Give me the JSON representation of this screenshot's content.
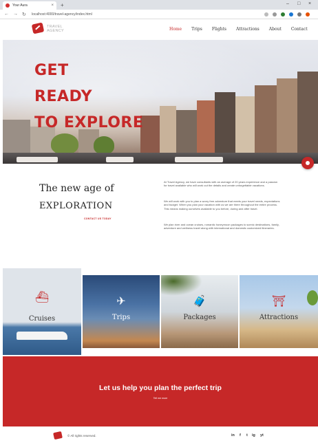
{
  "browser": {
    "tab_title": "Your Aura",
    "tab_close": "×",
    "new_tab": "+",
    "back": "←",
    "forward": "→",
    "reload": "↻",
    "url": "localhost:4000/travel-agency/index.html",
    "min": "–",
    "max": "□",
    "close": "×"
  },
  "header": {
    "logo_line1": "TRAVEL",
    "logo_line2": "AGENCY",
    "nav": [
      {
        "label": "Home"
      },
      {
        "label": "Trips"
      },
      {
        "label": "Flights"
      },
      {
        "label": "Attractions"
      },
      {
        "label": "About"
      },
      {
        "label": "Contact"
      }
    ]
  },
  "hero": {
    "line1": "GET",
    "line2": "READY",
    "line3": "TO EXPLORE"
  },
  "intro": {
    "heading_line1": "The new age of",
    "heading_line2": "EXPLORATION",
    "link": "CONTACT US TODAY",
    "paragraphs": [
      "At Travel Agency, we have consultants with an average of 20 years experience and a passion for travel available who will work out the details and create unforgettable vacations.",
      "We will work with you to plan a worry free adventure that meets your travel needs, expectations and budget. When you plan your vacation with us we are there throughout the entire process. This means making ourselves available to you before, during and after travel.",
      "We plan river and ocean cruises, romantic honeymoon packages to scenic destinations, family, adventure and wellness travel along with international and domestic customized itineraries."
    ]
  },
  "categories": [
    {
      "label": "Cruises",
      "icon": "ship-icon"
    },
    {
      "label": "Trips",
      "icon": "plane-icon"
    },
    {
      "label": "Packages",
      "icon": "luggage-icon"
    },
    {
      "label": "Attractions",
      "icon": "landmark-icon"
    }
  ],
  "cta": {
    "title": "Let us help you plan the perfect trip",
    "link": "Tell me more"
  },
  "footer": {
    "copyright": "© All rights reserved.",
    "social": [
      "in",
      "f",
      "t",
      "ig",
      "yt"
    ]
  },
  "colors": {
    "brand": "#c62828"
  }
}
